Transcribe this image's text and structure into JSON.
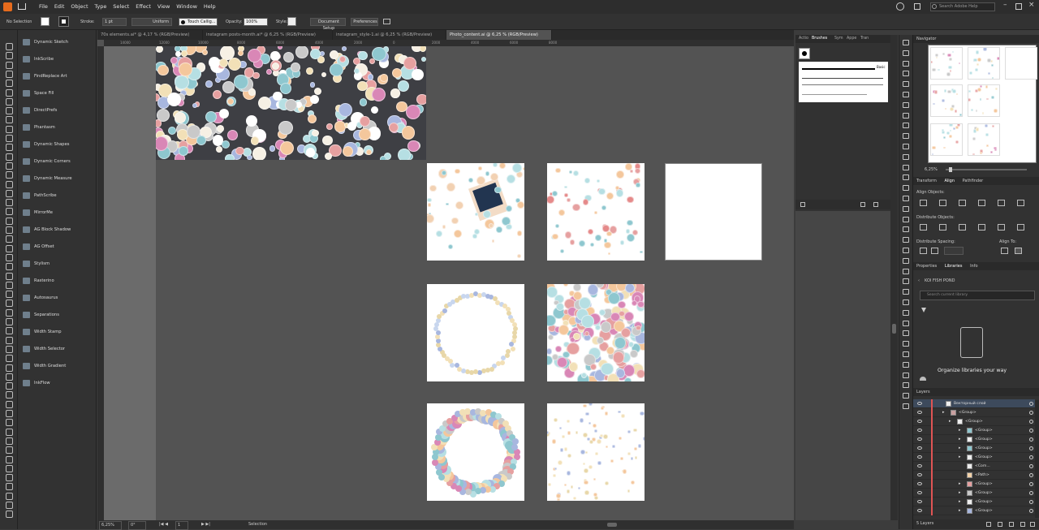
{
  "menubar": {
    "items": [
      "File",
      "Edit",
      "Object",
      "Type",
      "Select",
      "Effect",
      "View",
      "Window",
      "Help"
    ],
    "search_placeholder": "Search Adobe Help"
  },
  "control": {
    "selection_label": "No Selection",
    "stroke_label": "Stroke:",
    "stroke_weight": "1 pt",
    "uniform": "Uniform",
    "brush": "Touch Callig...",
    "opacity_label": "Opacity:",
    "opacity": "100%",
    "style_label": "Style:",
    "doc_setup": "Document Setup",
    "preferences": "Preferences"
  },
  "tabs": [
    {
      "label": "70s elements.ai* @ 4,17 % (RGB/Preview)"
    },
    {
      "label": "instagram posts-month.ai* @ 6,25 % (RGB/Preview)"
    },
    {
      "label": "instagram_style-1.ai @ 6,25 % (RGB/Preview)"
    },
    {
      "label": "Photo_content.ai @ 6,25 % (RGB/Preview)"
    }
  ],
  "plugins": [
    "Dynamic Sketch",
    "InkScribe",
    "FindReplace Art",
    "Space Fill",
    "DirectPrefs",
    "Phantasm",
    "Dynamic Shapes",
    "Dynamic Corners",
    "Dynamic Measure",
    "PathScribe",
    "MirrorMe",
    "AG Block Shadow",
    "AG Offset",
    "Stylism",
    "Rasterino",
    "Autosaurus",
    "Separations",
    "Width Stamp",
    "Width Selector",
    "Width Gradient",
    "InkFlow"
  ],
  "ruler": [
    "14000",
    "12000",
    "10000",
    "8000",
    "6000",
    "4000",
    "2000",
    "0",
    "2000",
    "4000",
    "6000",
    "8000"
  ],
  "status": {
    "zoom": "6,25%",
    "rotation": "0°",
    "page": "1",
    "selection": "Selection"
  },
  "brush_panel": {
    "tabs": [
      "Actio",
      "Brushes",
      "Sym",
      "Appe",
      "Tran"
    ],
    "basic_label": "Basic"
  },
  "navigator": {
    "title": "Navigator",
    "zoom": "6,25%"
  },
  "align": {
    "tabs": [
      "Transform",
      "Align",
      "Pathfinder"
    ],
    "align_objects": "Align Objects:",
    "distribute_objects": "Distribute Objects:",
    "distribute_spacing": "Distribute Spacing:",
    "align_to": "Align To:"
  },
  "libraries": {
    "tabs": [
      "Properties",
      "Libraries",
      "Info"
    ],
    "library_name": "KOI FISH POND",
    "search_placeholder": "Search current library",
    "empty_title": "Organize libraries your way"
  },
  "layers": {
    "title": "Layers",
    "count": "5 Layers",
    "rows": [
      "Векторный слой",
      "<Group>",
      "<Group>",
      "<Group>",
      "<Group>",
      "<Group>",
      "<Group>",
      "<Com...",
      "<Path>",
      "<Group>",
      "<Group>",
      "<Group>",
      "<Group>"
    ]
  },
  "colors": {
    "accent": "#2f8fd8",
    "layer_red": "#e05454",
    "canvas": "#535353",
    "artboard": "#ffffff"
  }
}
